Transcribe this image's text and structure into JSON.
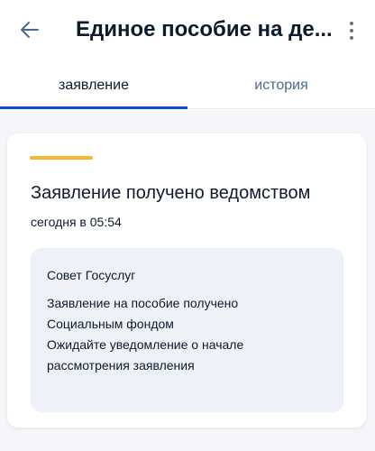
{
  "header": {
    "title": "Единое пособие на де...",
    "back_icon": "arrow-left-icon",
    "menu_icon": "more-vertical-icon"
  },
  "tabs": [
    {
      "label": "заявление",
      "active": true
    },
    {
      "label": "история",
      "active": false
    }
  ],
  "status_card": {
    "accent_color": "#f4b82d",
    "title": "Заявление получено ведомством",
    "time": "сегодня в 05:54",
    "advice": {
      "title": "Совет Госуслуг",
      "lines": [
        "Заявление на пособие получено",
        "Социальным фондом",
        "Ожидайте уведомление о начале",
        "рассмотрения заявления"
      ]
    }
  },
  "colors": {
    "primary": "#0d4cd3",
    "tab_inactive": "#4a6a8f",
    "advice_background": "#eef2f8"
  }
}
